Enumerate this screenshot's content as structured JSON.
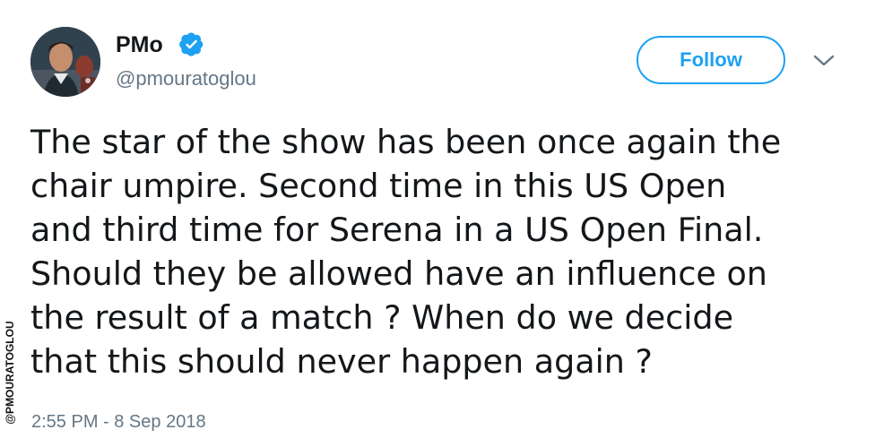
{
  "author": {
    "display_name": "PMo",
    "handle": "@pmouratoglou",
    "verified": true
  },
  "follow_button": {
    "label": "Follow"
  },
  "icons": {
    "verified": "verified-check-icon",
    "more": "chevron-down-icon"
  },
  "tweet": {
    "lines": [
      "The star of the show has been once again the",
      "chair umpire. Second time in this US Open",
      "and third time for Serena in a US Open Final.",
      "Should they be allowed have an influence on",
      "the result of a match ? When do we decide",
      "that this should never happen again ?"
    ],
    "timestamp": "2:55 PM - 8 Sep 2018"
  },
  "watermark": {
    "text": "@PMOURATOGLOU"
  },
  "colors": {
    "accent": "#1da1f2",
    "text": "#14171a",
    "secondary": "#657786"
  }
}
